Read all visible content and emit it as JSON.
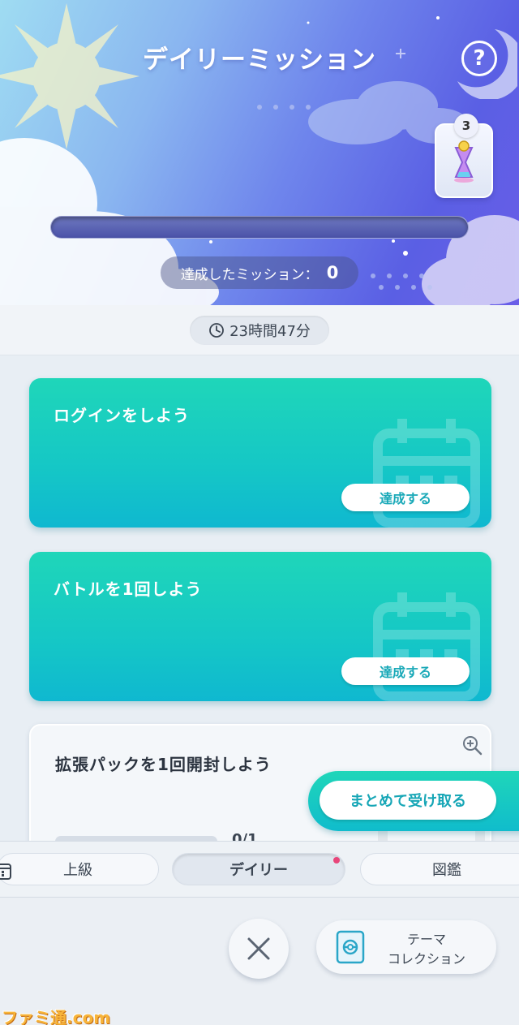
{
  "header": {
    "title": "デイリーミッション",
    "help_label": "?",
    "reward_count": "3",
    "progress": 0,
    "achieved_label": "達成したミッション：",
    "achieved_count": "0"
  },
  "timer": {
    "remaining": "23時間47分"
  },
  "missions": [
    {
      "label": "ログインをしよう",
      "button": "達成する",
      "status": "complete"
    },
    {
      "label": "バトルを1回しよう",
      "button": "達成する",
      "status": "complete"
    },
    {
      "label": "拡張パックを1回開封しよう",
      "progress": "0/1",
      "status": "in-progress"
    }
  ],
  "claim_all": {
    "label": "まとめて受け取る"
  },
  "tabs": [
    {
      "label": "上級",
      "active": false
    },
    {
      "label": "デイリー",
      "active": true,
      "notify": true
    },
    {
      "label": "図鑑",
      "active": false
    }
  ],
  "bottom": {
    "theme_line1": "テーマ",
    "theme_line2": "コレクション"
  },
  "watermark": "ファミ通.com",
  "colors": {
    "mission_complete": "#15c7c6",
    "accent": "#16a6b6",
    "notify_dot": "#e8457a"
  }
}
